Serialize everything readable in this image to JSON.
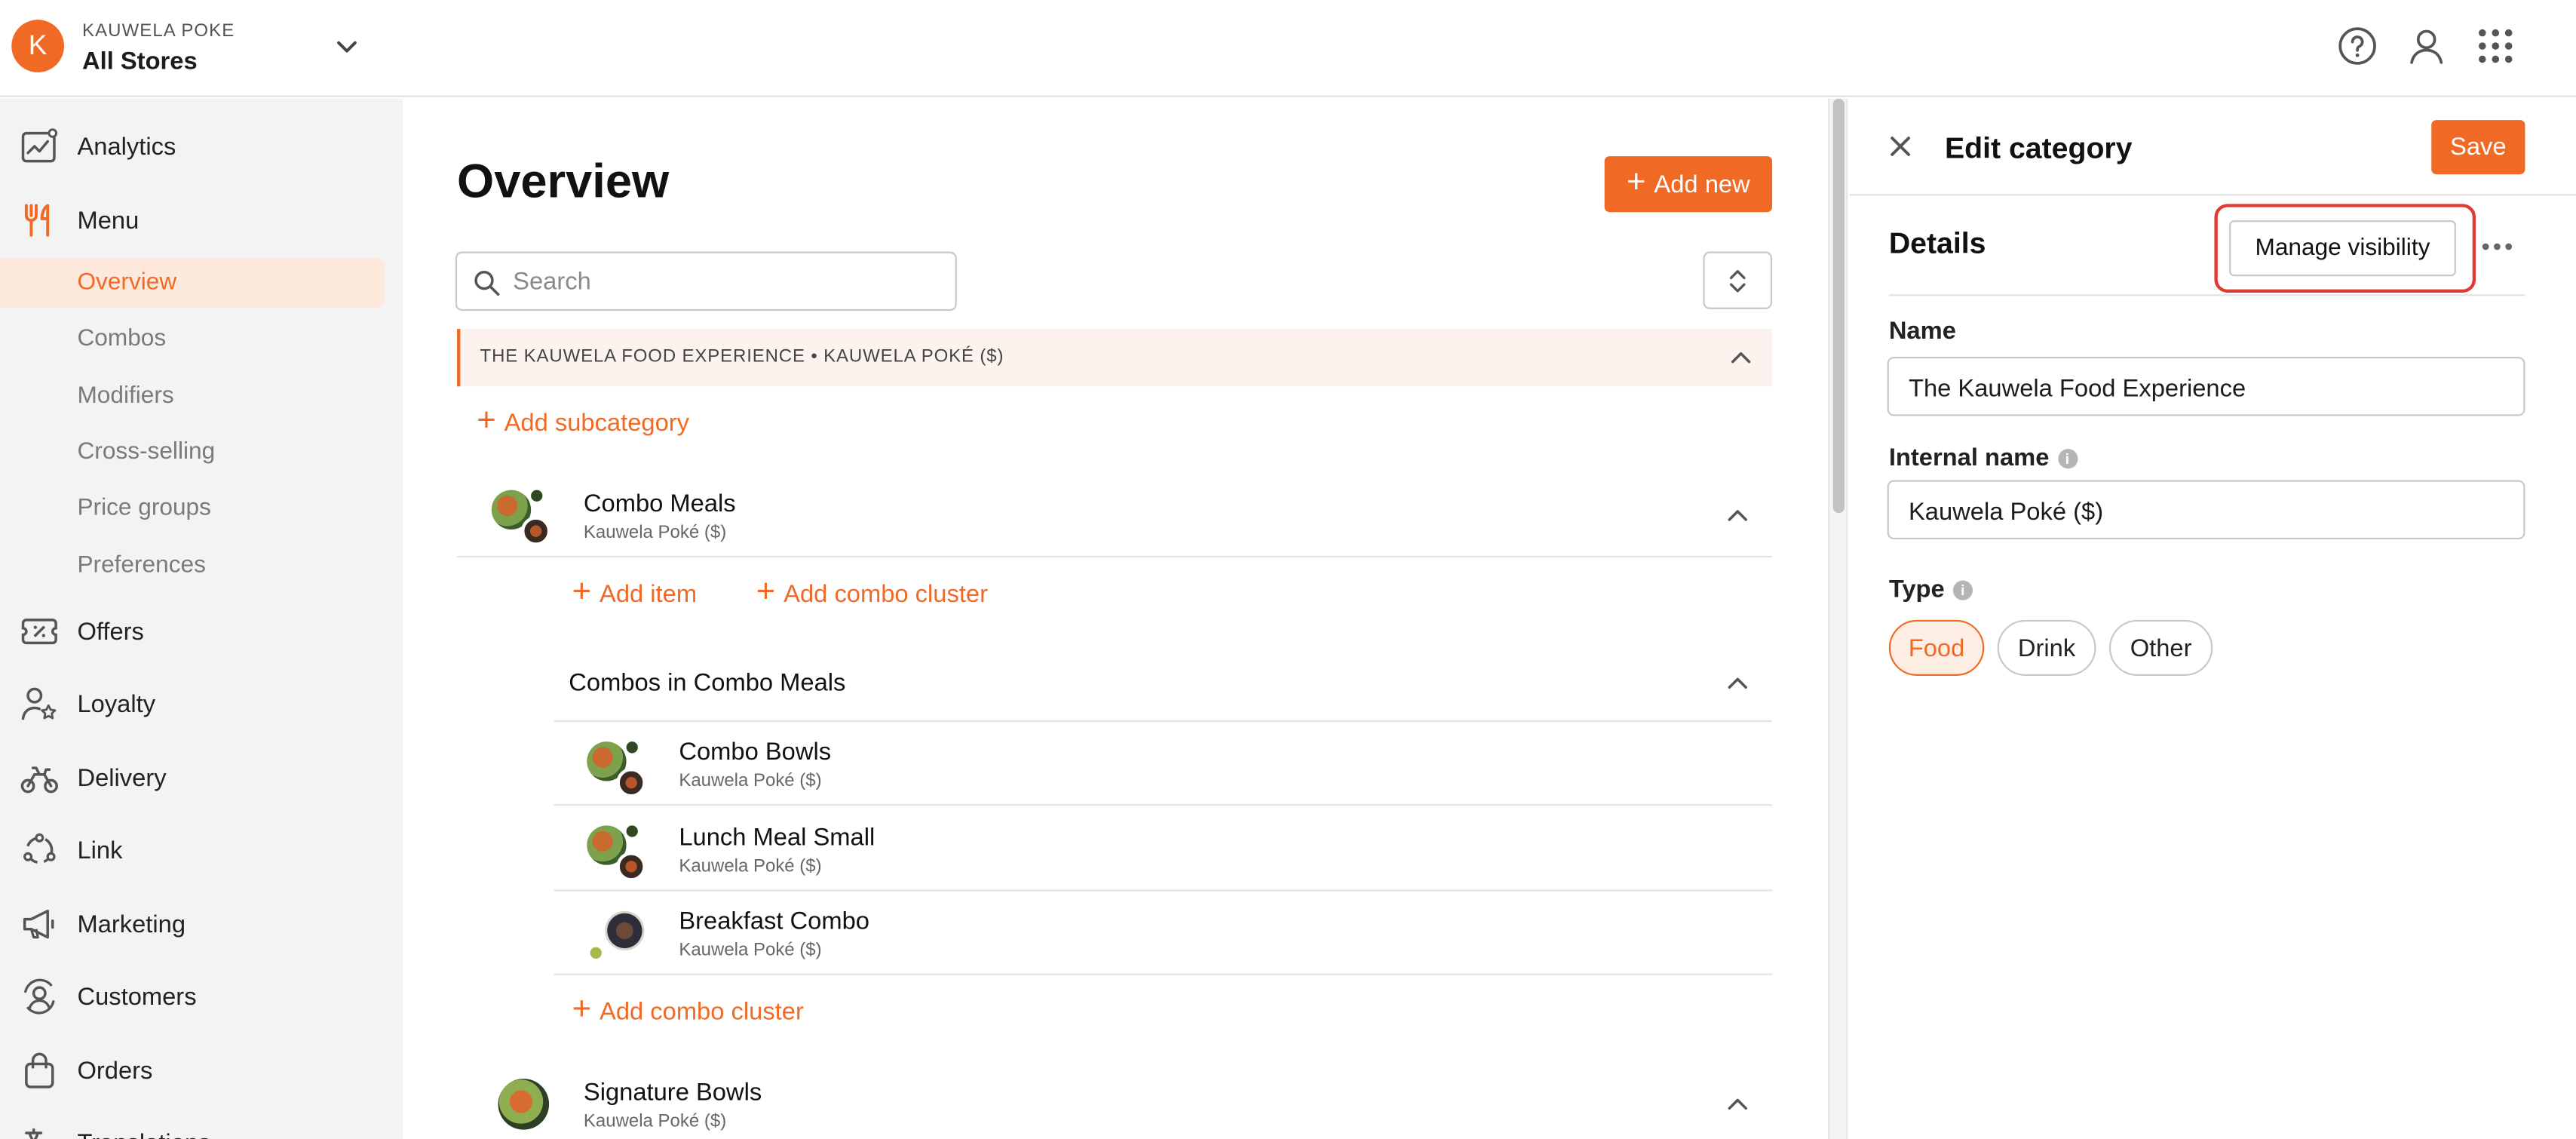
{
  "brand": {
    "initial": "K",
    "name": "KAUWELA POKE",
    "store": "All Stores"
  },
  "sidebar": {
    "items": [
      {
        "label": "Analytics",
        "icon": "analytics-icon"
      },
      {
        "label": "Menu",
        "icon": "menu-fork-knife-icon"
      },
      {
        "label": "Offers",
        "icon": "offers-ticket-icon"
      },
      {
        "label": "Loyalty",
        "icon": "loyalty-person-star-icon"
      },
      {
        "label": "Delivery",
        "icon": "delivery-bike-icon"
      },
      {
        "label": "Link",
        "icon": "link-network-icon"
      },
      {
        "label": "Marketing",
        "icon": "marketing-megaphone-icon"
      },
      {
        "label": "Customers",
        "icon": "customers-icon"
      },
      {
        "label": "Orders",
        "icon": "orders-bag-icon"
      },
      {
        "label": "Translations",
        "icon": "translations-icon"
      }
    ],
    "menu_subitems": [
      "Overview",
      "Combos",
      "Modifiers",
      "Cross-selling",
      "Price groups",
      "Preferences"
    ],
    "active_subitem": "Overview"
  },
  "main": {
    "title": "Overview",
    "add_new_label": "Add new",
    "search_placeholder": "Search",
    "category_header": "THE KAUWELA FOOD EXPERIENCE • KAUWELA POKÉ ($)",
    "add_subcategory": "Add subcategory",
    "combo_meals": {
      "title": "Combo Meals",
      "subtitle": "Kauwela Poké ($)"
    },
    "add_item": "Add item",
    "add_combo_cluster": "Add combo cluster",
    "combos_header": "Combos in Combo Meals",
    "combos": [
      {
        "title": "Combo Bowls",
        "subtitle": "Kauwela Poké ($)"
      },
      {
        "title": "Lunch Meal Small",
        "subtitle": "Kauwela Poké ($)"
      },
      {
        "title": "Breakfast Combo",
        "subtitle": "Kauwela Poké ($)"
      }
    ],
    "add_combo_cluster_2": "Add combo cluster",
    "signature_bowls": {
      "title": "Signature Bowls",
      "subtitle": "Kauwela Poké ($)"
    }
  },
  "panel": {
    "title": "Edit category",
    "save_label": "Save",
    "details_title": "Details",
    "manage_visibility_label": "Manage visibility",
    "name_label": "Name",
    "name_value": "The Kauwela Food Experience",
    "internal_name_label": "Internal name",
    "internal_name_value": "Kauwela Poké ($)",
    "type_label": "Type",
    "types": [
      "Food",
      "Drink",
      "Other"
    ],
    "selected_type": "Food"
  },
  "colors": {
    "accent": "#f06a26",
    "highlight": "#e03a32",
    "sidebar_bg": "#f3f3f3",
    "active_bg": "#fde9dc"
  }
}
